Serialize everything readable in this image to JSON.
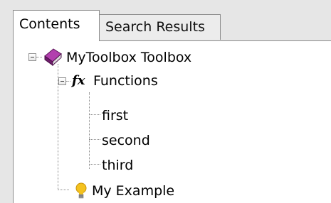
{
  "tabs": [
    {
      "label": "Contents",
      "active": true
    },
    {
      "label": "Search Results",
      "active": false
    }
  ],
  "tree": {
    "root": {
      "label": "MyToolbox Toolbox",
      "icon": "book-icon",
      "expanded": true
    },
    "functions": {
      "label": "Functions",
      "icon": "fx-icon",
      "icon_text": "fx",
      "expanded": true
    },
    "items": [
      "first",
      "second",
      "third"
    ],
    "example": {
      "label": "My Example",
      "icon": "lightbulb-icon"
    }
  },
  "colors": {
    "book": "#8e2a8c",
    "bulb": "#f4c21f"
  }
}
